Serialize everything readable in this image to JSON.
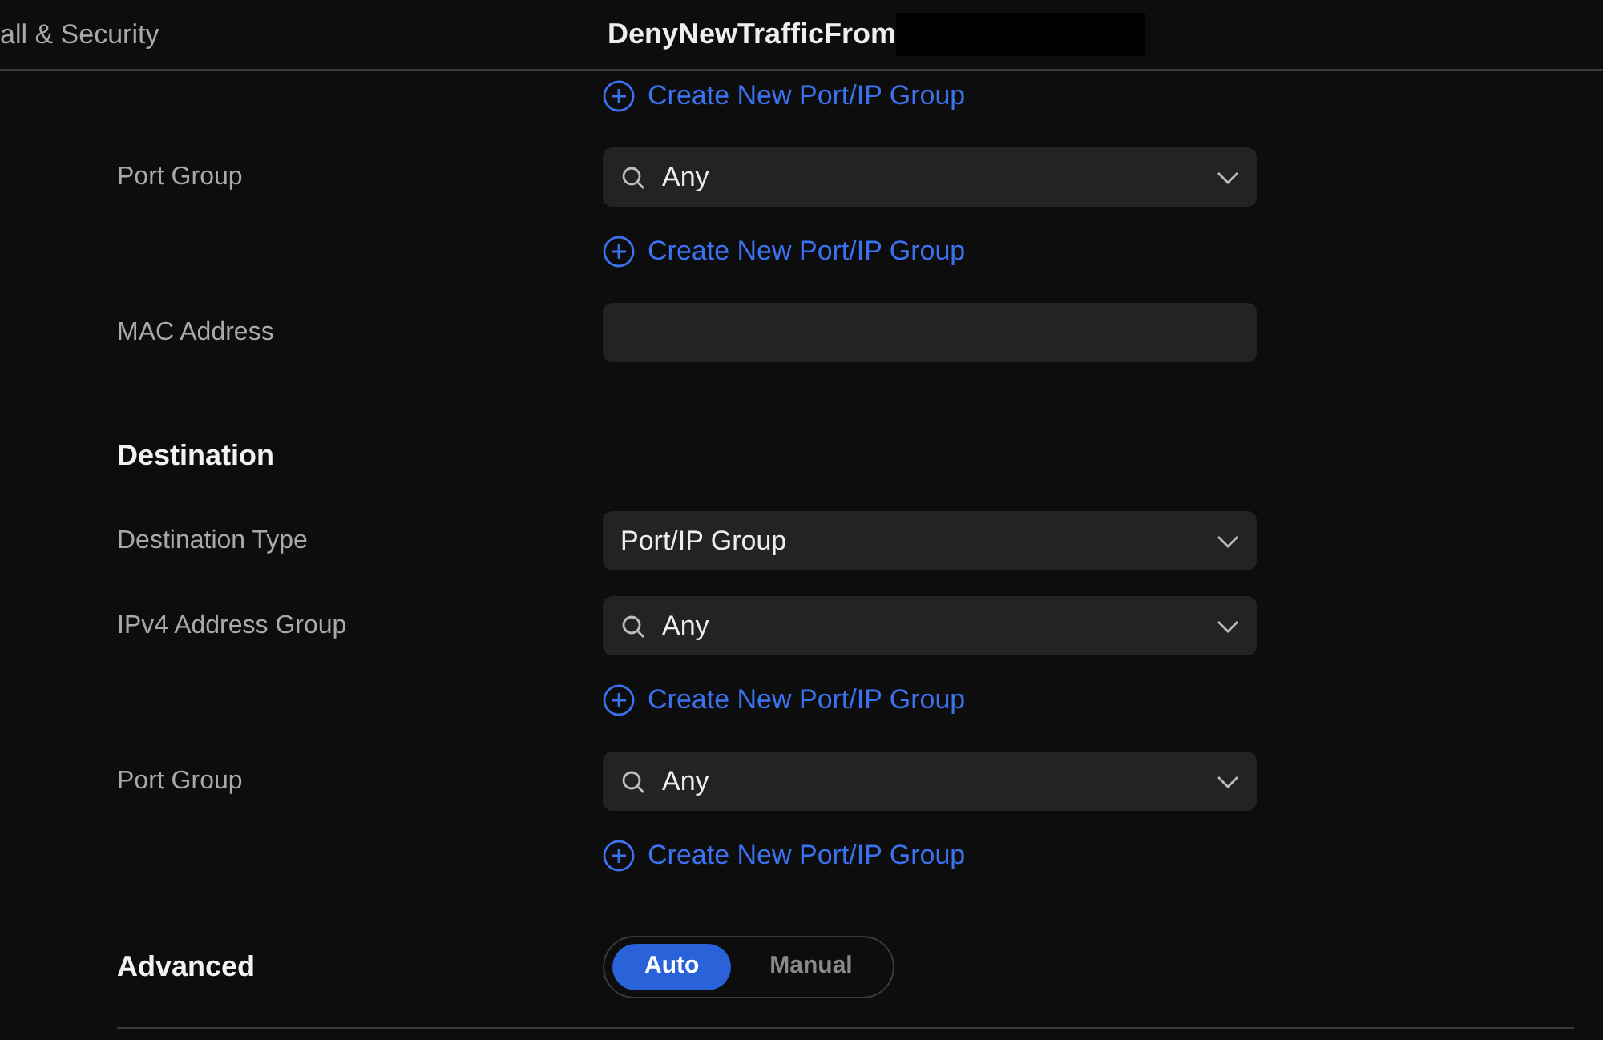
{
  "header": {
    "breadcrumb": "all & Security",
    "title": "DenyNewTrafficFrom"
  },
  "rows": [
    {
      "kind": "link",
      "label": "Create New Port/IP Group"
    },
    {
      "kind": "select",
      "label": "Port Group",
      "value": "Any",
      "searchable": true
    },
    {
      "kind": "link",
      "label": "Create New Port/IP Group"
    },
    {
      "kind": "input",
      "label": "MAC Address"
    },
    {
      "kind": "heading",
      "label": "Destination"
    },
    {
      "kind": "select",
      "label": "Destination Type",
      "value": "Port/IP Group",
      "searchable": false
    },
    {
      "kind": "select",
      "label": "IPv4 Address Group",
      "value": "Any",
      "searchable": true
    },
    {
      "kind": "link",
      "label": "Create New Port/IP Group"
    },
    {
      "kind": "select",
      "label": "Port Group",
      "value": "Any",
      "searchable": true
    },
    {
      "kind": "link",
      "label": "Create New Port/IP Group"
    },
    {
      "kind": "segmented",
      "label": "Advanced",
      "options": [
        {
          "label": "Auto",
          "selected": true
        },
        {
          "label": "Manual",
          "selected": false
        }
      ]
    }
  ]
}
